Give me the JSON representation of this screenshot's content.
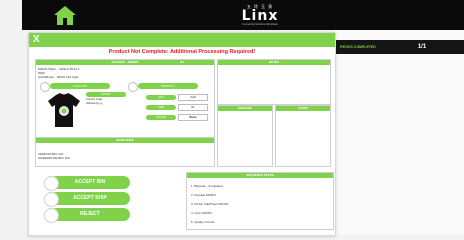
{
  "brand": {
    "jp": "五 玲 玉 泉",
    "word": "Linx",
    "tagline": "Connecting Solutions Worldwide"
  },
  "dialog": {
    "close": "X",
    "alert": "Product Not Complete: Additional Processing Required!"
  },
  "order_panel": {
    "header": "BUILDER · ORDER",
    "page": "0/1",
    "line1": "MARTH BALL · SIZE # 45/14 F",
    "line2": "0000",
    "line3": "QuickBrown · #0001 F10 Fg2c",
    "location_label": "LOCATION",
    "location_value": "FRONT",
    "location_sub": "Imprint Area",
    "location_text": "ICE/Ice(s) g",
    "product_label": "PRODUCT",
    "rows": [
      {
        "label": "SKU",
        "value": "C12"
      },
      {
        "label": "SIZE",
        "value": "XL"
      },
      {
        "label": "COLOR",
        "value": "Black"
      }
    ],
    "notes_label": "NOTE"
  },
  "notes_panel": {
    "header": "NOTES"
  },
  "designs_panel": {
    "header": "DESIGNS"
  },
  "steps_panel": {
    "header": "STEPS"
  },
  "barcodes": {
    "header": "BARCODES",
    "line1": "VENDOR BIN: N/A",
    "line2": "WAREHOUSE BIN: N/A"
  },
  "actions": {
    "accept_bin": "ACCEPT BIN",
    "accept_ship": "ACCEPT SHIP",
    "reject": "REJECT"
  },
  "sequence": {
    "header": "SEQUENCE STEPS",
    "items": [
      "1. Barcode - Completed",
      "2. Pretreat FRONT",
      "3. Printer ICE/Press FRONT",
      "4. Cure FRONT",
      "5. Quality Control"
    ]
  },
  "progress": {
    "label": "PIECES COMPLETED",
    "count": "1/1"
  },
  "colors": {
    "accent": "#7fd24a",
    "alert": "#e02020",
    "dark": "#0a0a0a"
  }
}
